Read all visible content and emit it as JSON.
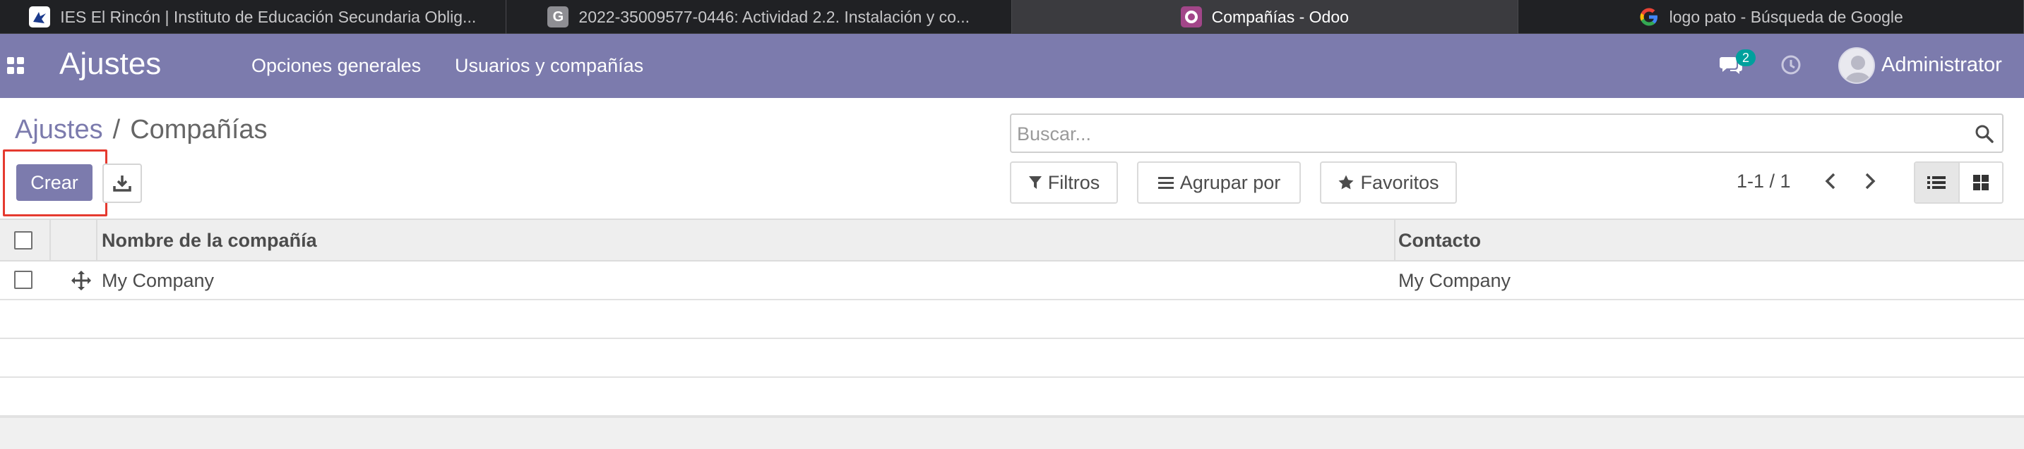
{
  "browser": {
    "tabs": [
      {
        "title": "IES El Rincón | Instituto de Educación Secundaria Oblig...",
        "icon": "ies-logo-icon",
        "active": false
      },
      {
        "title": "2022-35009577-0446: Actividad 2.2. Instalación y co...",
        "icon": "g-letter-icon",
        "active": false
      },
      {
        "title": "Compañías - Odoo",
        "icon": "odoo-icon",
        "active": true
      },
      {
        "title": "logo pato - Búsqueda de Google",
        "icon": "google-icon",
        "active": false
      }
    ]
  },
  "navbar": {
    "brand": "Ajustes",
    "menu": [
      "Opciones generales",
      "Usuarios y compañías"
    ],
    "chat_badge": "2",
    "user_name": "Administrator",
    "color": "#7c7bad"
  },
  "control_panel": {
    "breadcrumb": {
      "parent": "Ajustes",
      "separator": "/",
      "current": "Compañías"
    },
    "search": {
      "placeholder": "Buscar...",
      "value": ""
    },
    "create_label": "Crear",
    "filters_label": "Filtros",
    "group_by_label": "Agrupar por",
    "favorites_label": "Favoritos",
    "pager": "1-1 / 1",
    "active_view": "list"
  },
  "table": {
    "columns": [
      "Nombre de la compañía",
      "Contacto"
    ],
    "rows": [
      {
        "name": "My Company",
        "contact": "My Company"
      }
    ]
  },
  "colors": {
    "accent": "#7c7bad",
    "badge": "#00a09d",
    "highlight": "#e53a2f"
  }
}
